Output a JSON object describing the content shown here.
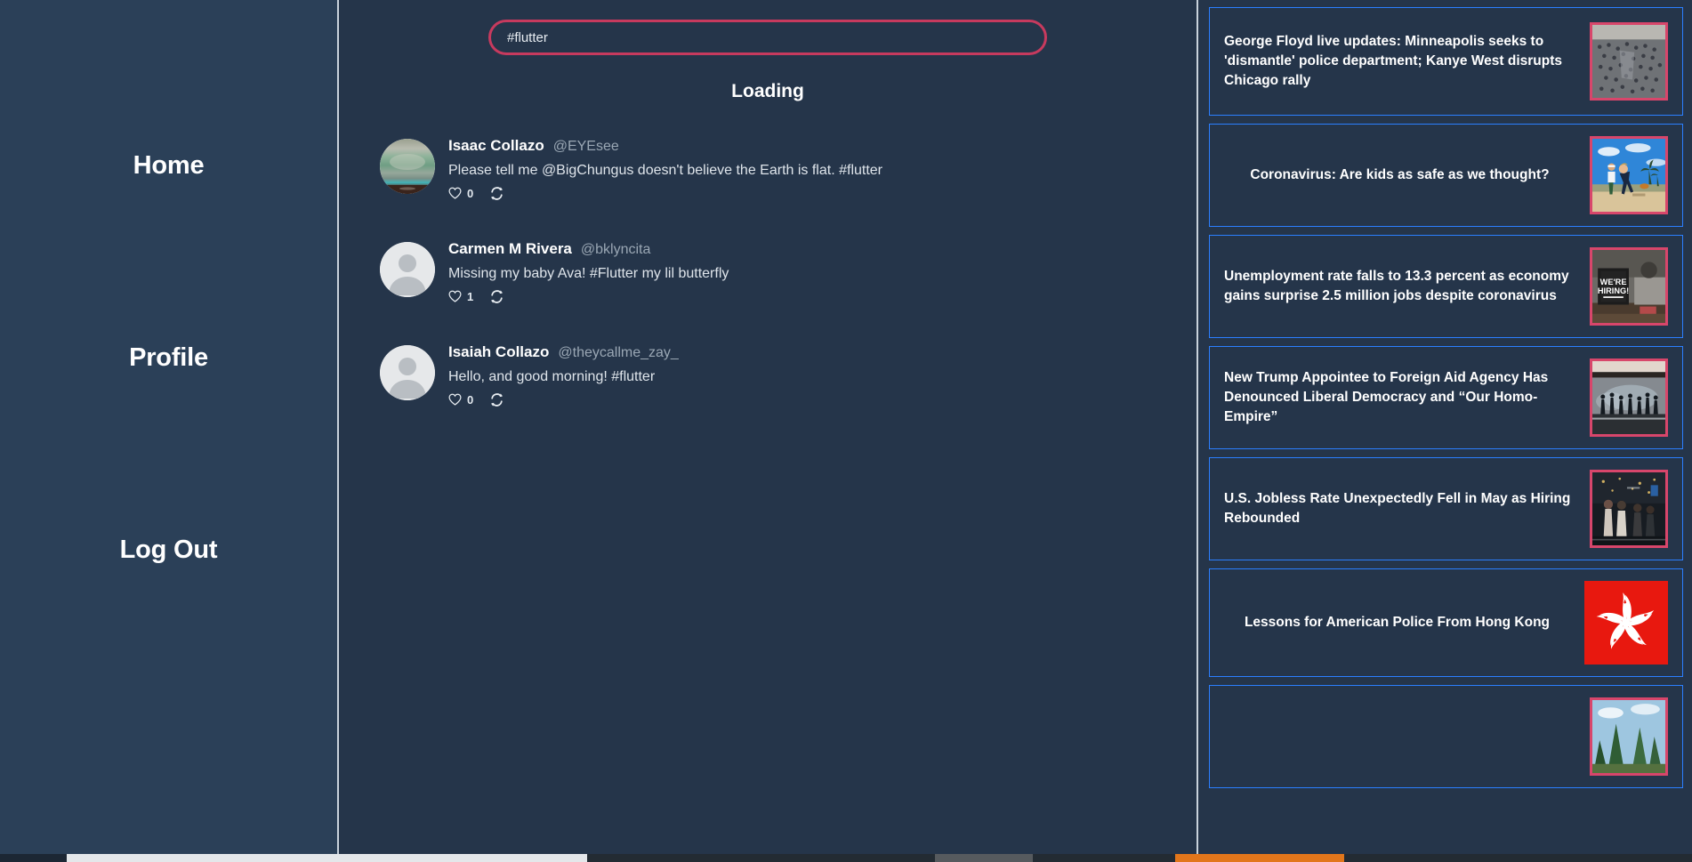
{
  "sidebar": {
    "items": [
      {
        "label": "Home",
        "name": "sidebar-item-home"
      },
      {
        "label": "Profile",
        "name": "sidebar-item-profile"
      },
      {
        "label": "Log Out",
        "name": "sidebar-item-logout"
      }
    ]
  },
  "search": {
    "value": "#flutter",
    "placeholder": "Search"
  },
  "feed": {
    "status_label": "Loading",
    "tweets": [
      {
        "name": "Isaac Collazo",
        "handle": "@EYEsee",
        "text": "Please tell me @BigChungus doesn't believe the Earth is flat. #flutter",
        "likes": "0",
        "avatar_type": "photo-landscape",
        "like_icon": "heart-icon",
        "retweet_icon": "retweet-icon"
      },
      {
        "name": "Carmen M Rivera",
        "handle": "@bklyncita",
        "text": "Missing my baby Ava! #Flutter my lil butterfly",
        "likes": "1",
        "avatar_type": "default-person",
        "like_icon": "heart-icon",
        "retweet_icon": "retweet-icon"
      },
      {
        "name": "Isaiah Collazo",
        "handle": "@theycallme_zay_",
        "text": "Hello, and good morning! #flutter",
        "likes": "0",
        "avatar_type": "default-person",
        "like_icon": "heart-icon",
        "retweet_icon": "retweet-icon"
      }
    ]
  },
  "news": {
    "articles": [
      {
        "title": "George Floyd live updates: Minneapolis seeks to 'dismantle' police department; Kanye West disrupts Chicago rally",
        "align": "left",
        "thumb": "crowd-protest-aerial"
      },
      {
        "title": "Coronavirus: Are kids as safe as we thought?",
        "align": "center",
        "thumb": "beach-kids-running"
      },
      {
        "title": "Unemployment rate falls to 13.3 percent as economy gains surprise 2.5 million jobs despite coronavirus",
        "align": "left",
        "thumb": "were-hiring-sign"
      },
      {
        "title": "New Trump Appointee to Foreign Aid Agency Has Denounced Liberal Democracy and “Our Homo-Empire”",
        "align": "left",
        "thumb": "tear-gas-street"
      },
      {
        "title": "U.S. Jobless Rate Unexpectedly Fell in May as Hiring Rebounded",
        "align": "left",
        "thumb": "night-street-crowd"
      },
      {
        "title": "Lessons for American Police From Hong Kong",
        "align": "center",
        "thumb": "hong-kong-flag"
      },
      {
        "title": "",
        "align": "left",
        "thumb": "trees-sky"
      }
    ]
  },
  "colors": {
    "sidebar_bg": "#2b4058",
    "main_bg": "#25354a",
    "accent_pink": "#c73a5e",
    "news_border_blue": "#2b7fff",
    "thumb_border": "#d8466b",
    "divider": "#c8d2dc"
  }
}
